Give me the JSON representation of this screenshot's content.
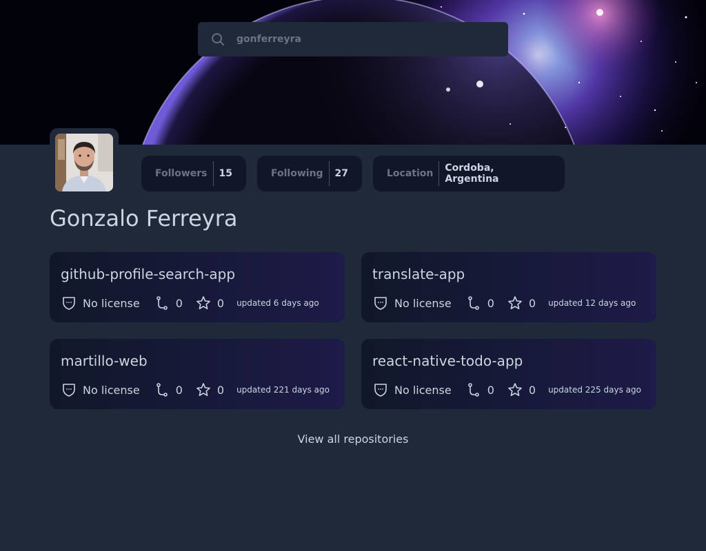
{
  "search": {
    "value": "gonferreyra",
    "placeholder": "gonferreyra"
  },
  "profile": {
    "name": "Gonzalo Ferreyra",
    "stats": {
      "followers_label": "Followers",
      "followers_value": "15",
      "following_label": "Following",
      "following_value": "27",
      "location_label": "Location",
      "location_value": "Cordoba, Argentina"
    }
  },
  "repos": [
    {
      "name": "github-profile-search-app",
      "license": "No license",
      "forks": "0",
      "stars": "0",
      "updated": "updated 6 days ago"
    },
    {
      "name": "translate-app",
      "license": "No license",
      "forks": "0",
      "stars": "0",
      "updated": "updated 12 days ago"
    },
    {
      "name": "martillo-web",
      "license": "No license",
      "forks": "0",
      "stars": "0",
      "updated": "updated 221 days ago"
    },
    {
      "name": "react-native-todo-app",
      "license": "No license",
      "forks": "0",
      "stars": "0",
      "updated": "updated 225 days ago"
    }
  ],
  "view_all_label": "View all repositories",
  "icons": {
    "search": "search-icon",
    "license": "license-shield-icon",
    "fork": "fork-icon",
    "star": "star-icon"
  },
  "colors": {
    "background": "#20293a",
    "card": "#111729",
    "card_gradient_end": "#1d1b48",
    "text": "#cdd5e0",
    "muted": "#6b7486"
  }
}
